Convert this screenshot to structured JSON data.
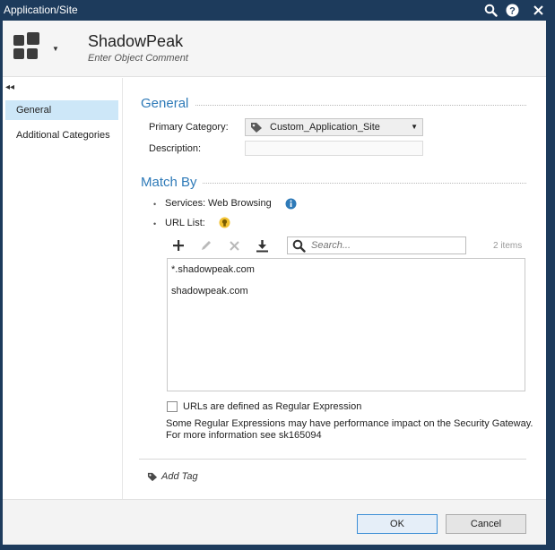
{
  "window": {
    "title": "Application/Site",
    "icons": [
      "search-icon",
      "help-icon",
      "close-icon"
    ]
  },
  "header": {
    "name": "ShadowPeak",
    "comment_placeholder": "Enter Object Comment",
    "icon": "application-grid-icon"
  },
  "sidebar": {
    "items": [
      {
        "label": "General",
        "active": true
      },
      {
        "label": "Additional Categories",
        "active": false
      }
    ]
  },
  "general": {
    "title": "General",
    "primary_category_label": "Primary Category:",
    "primary_category_value": "Custom_Application_Site",
    "description_label": "Description:",
    "description_value": ""
  },
  "match_by": {
    "title": "Match By",
    "services_label": "Services:",
    "services_value": "Web Browsing",
    "url_list_label": "URL List:",
    "search_placeholder": "Search...",
    "items_count": "2 items",
    "urls": [
      "*.shadowpeak.com",
      "shadowpeak.com"
    ],
    "regex_checkbox_label": "URLs are defined as Regular Expression",
    "regex_checked": false,
    "note_line1": "Some Regular Expressions may have performance impact on the Security Gateway.",
    "note_line2": "For more information see sk165094"
  },
  "add_tag_label": "Add Tag",
  "footer": {
    "ok_label": "OK",
    "cancel_label": "Cancel"
  },
  "colors": {
    "title_bar": "#1d3b5c",
    "accent": "#2e7ab8",
    "nav_active": "#cde7f8"
  }
}
